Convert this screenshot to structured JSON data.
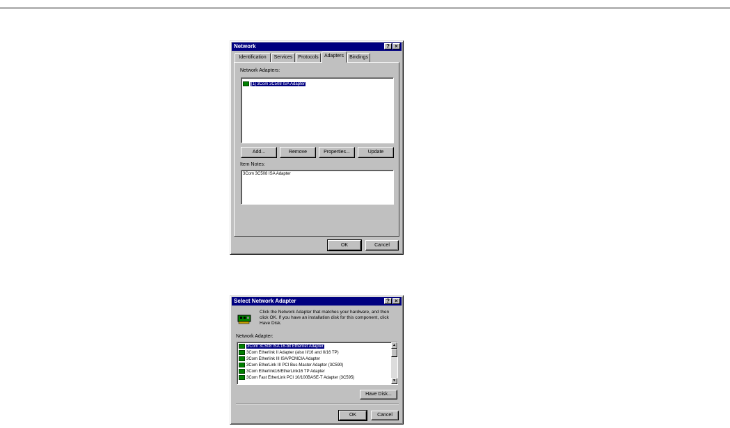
{
  "network_dialog": {
    "title": "Network",
    "help_btn": "?",
    "close_btn": "×",
    "tabs": [
      {
        "label": "Identification"
      },
      {
        "label": "Services"
      },
      {
        "label": "Protocols"
      },
      {
        "label": "Adapters",
        "active": true
      },
      {
        "label": "Bindings"
      }
    ],
    "adapters_label": "Network Adapters:",
    "adapters": [
      "[1] 3Com 3C508 ISA Adapter"
    ],
    "buttons": {
      "add": "Add...",
      "remove": "Remove",
      "properties": "Properties...",
      "update": "Update"
    },
    "item_notes_label": "Item Notes:",
    "item_notes": "3Com 3C508 ISA Adapter",
    "ok": "OK",
    "cancel": "Cancel"
  },
  "select_dialog": {
    "title": "Select Network Adapter",
    "help_btn": "?",
    "close_btn": "×",
    "instructions": "Click the Network Adapter that matches your hardware, and then click OK.  If you have an installation disk for this component, click Have Disk.",
    "list_label": "Network Adapter:",
    "items": [
      "3Com 3C508 ISA 16-bit Ethernet Adapter",
      "3Com Etherlink II Adapter (also II/16 and II/16 TP)",
      "3Com Etherlink III ISA/PCMCIA Adapter",
      "3Com EtherLink III PCI Bus-Master Adapter (3C590)",
      "3Com Etherlink16/EtherLink16 TP Adapter",
      "3Com Fast EtherLink PCI 10/100BASE-T Adapter (3C595)"
    ],
    "have_disk": "Have Disk...",
    "ok": "OK",
    "cancel": "Cancel"
  }
}
